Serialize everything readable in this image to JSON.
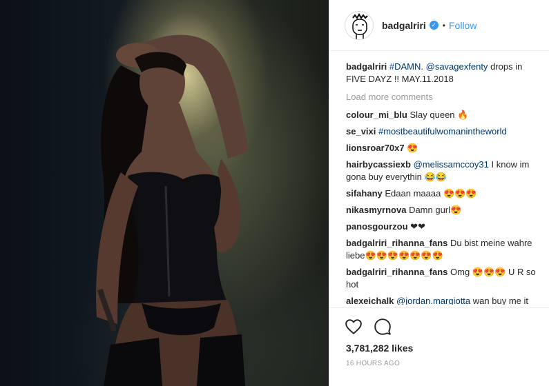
{
  "post": {
    "image_alt": "Photo",
    "author": "badgalriri",
    "verified": true,
    "dot": "•",
    "follow_label": "Follow"
  },
  "caption": {
    "user": "badgalriri",
    "tag1": "#DAMN.",
    "tag2": "@savagexfenty",
    "text": "drops in FIVE DAYZ !! MAY.11.2018"
  },
  "load_more": "Load more comments",
  "comments": [
    {
      "user": "colour_mi_blu",
      "mention": "",
      "text": "Slay queen 🔥"
    },
    {
      "user": "se_vixi",
      "mention": "#mostbeautifulwomanintheworld",
      "text": ""
    },
    {
      "user": "lionsroar70x7",
      "mention": "",
      "text": "😍"
    },
    {
      "user": "hairbycassiexb",
      "mention": "@melissamccoy31",
      "text": "I know im gona buy everythin 😂😂"
    },
    {
      "user": "sifahany",
      "mention": "",
      "text": "Edaan maaaa 😍😍😍"
    },
    {
      "user": "nikasmyrnova",
      "mention": "",
      "text": "Damn gurl😍"
    },
    {
      "user": "panosgourzou",
      "mention": "",
      "text": "❤❤"
    },
    {
      "user": "badgalriri_rihanna_fans",
      "mention": "",
      "text": "Du bist meine wahre liebe😍😍😍😍😍😍😍"
    },
    {
      "user": "badgalriri_rihanna_fans",
      "mention": "",
      "text": "Omg 😍😍😍 U R so hot"
    },
    {
      "user": "alexeichalk",
      "mention": "@jordan.margiotta",
      "text": "wan buy me it"
    }
  ],
  "actions": {
    "like_icon": "heart-outline-icon",
    "comment_icon": "comment-bubble-icon",
    "likes": "3,781,282 likes",
    "time": "16 HOURS AGO"
  }
}
